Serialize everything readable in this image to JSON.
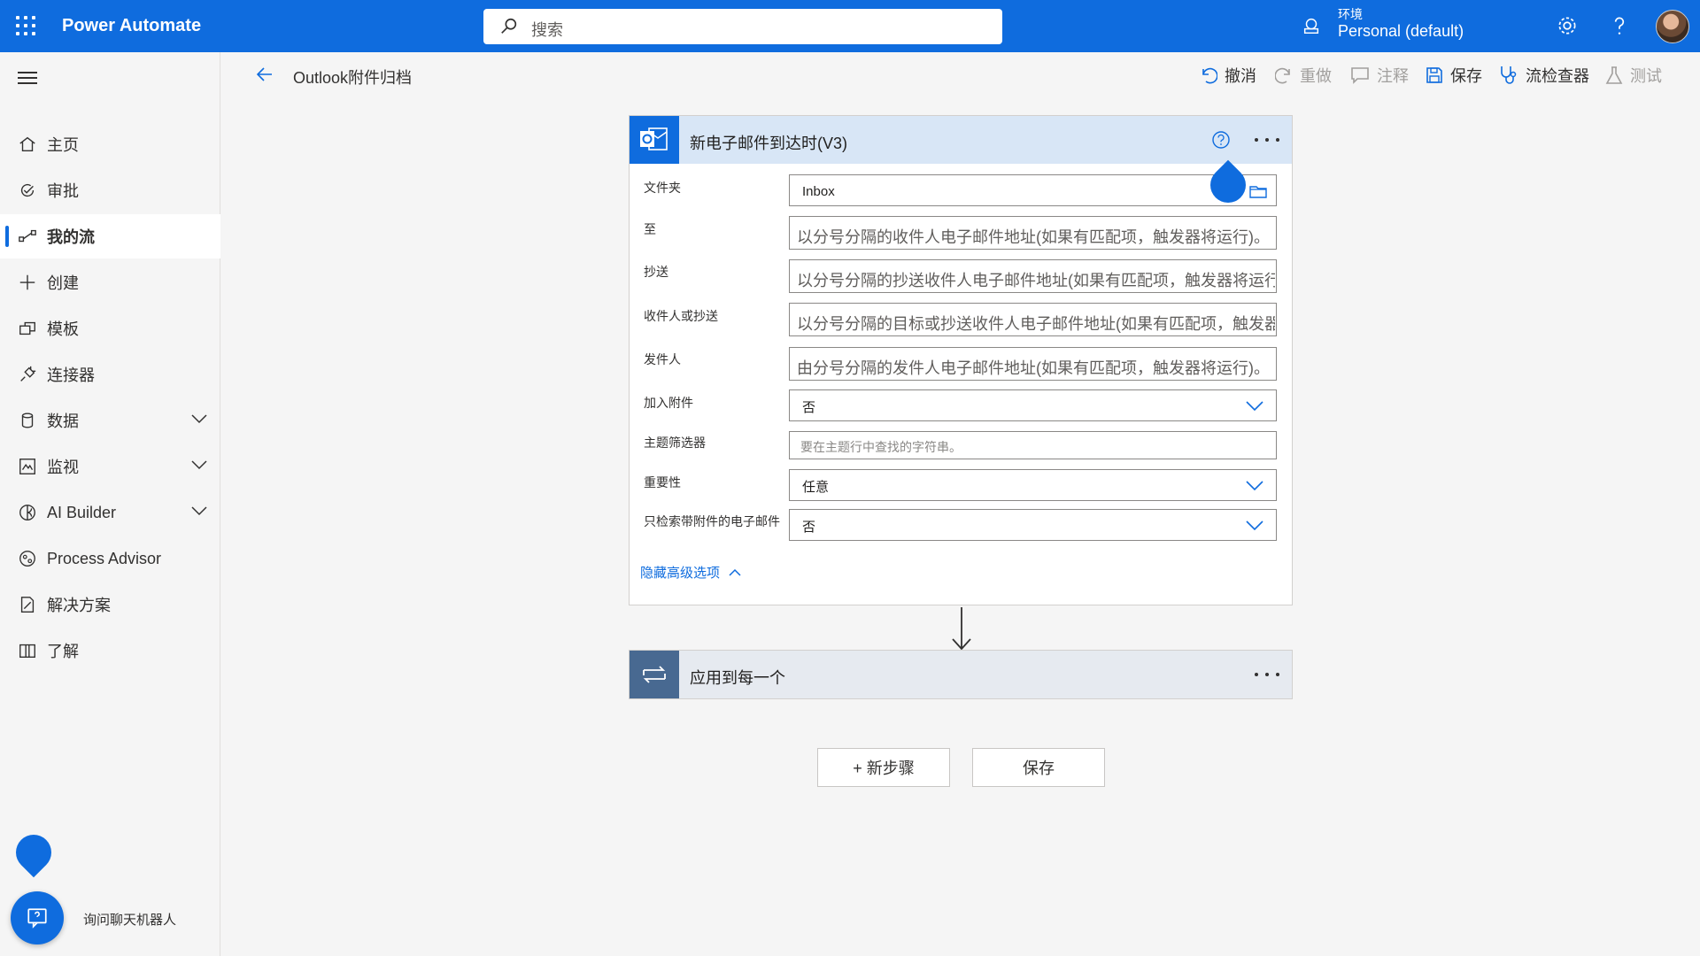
{
  "app": {
    "title": "Power Automate"
  },
  "search": {
    "placeholder": "搜索"
  },
  "environment": {
    "label": "环境",
    "value": "Personal (default)"
  },
  "sidebar": {
    "items": [
      {
        "label": "主页",
        "icon": "home-icon"
      },
      {
        "label": "审批",
        "icon": "approvals-icon"
      },
      {
        "label": "我的流",
        "icon": "flow-icon",
        "active": true
      },
      {
        "label": "创建",
        "icon": "plus-icon"
      },
      {
        "label": "模板",
        "icon": "template-icon"
      },
      {
        "label": "连接器",
        "icon": "connector-icon"
      },
      {
        "label": "数据",
        "icon": "database-icon",
        "expandable": true
      },
      {
        "label": "监视",
        "icon": "monitor-icon",
        "expandable": true
      },
      {
        "label": "AI Builder",
        "icon": "ai-builder-icon",
        "expandable": true
      },
      {
        "label": "Process Advisor",
        "icon": "process-advisor-icon"
      },
      {
        "label": "解决方案",
        "icon": "solutions-icon"
      },
      {
        "label": "了解",
        "icon": "book-icon"
      }
    ],
    "chatbot_label": "询问聊天机器人"
  },
  "commandbar": {
    "flow_title": "Outlook附件归档",
    "undo": "撤消",
    "redo": "重做",
    "comment": "注释",
    "save": "保存",
    "checker": "流检查器",
    "test": "测试"
  },
  "trigger": {
    "title": "新电子邮件到达时(V3)",
    "fields": {
      "folder": {
        "label": "文件夹",
        "value": "Inbox"
      },
      "to": {
        "label": "至",
        "placeholder": "以分号分隔的收件人电子邮件地址(如果有匹配项，触发器将运行)。"
      },
      "cc": {
        "label": "抄送",
        "placeholder": "以分号分隔的抄送收件人电子邮件地址(如果有匹配项，触发器将运行)。"
      },
      "to_or_cc": {
        "label": "收件人或抄送",
        "placeholder": "以分号分隔的目标或抄送收件人电子邮件地址(如果有匹配项，触发器将运行)。"
      },
      "from": {
        "label": "发件人",
        "placeholder": "由分号分隔的发件人电子邮件地址(如果有匹配项，触发器将运行)。"
      },
      "include_attachments": {
        "label": "加入附件",
        "value": "否"
      },
      "subject_filter": {
        "label": "主题筛选器",
        "placeholder": "要在主题行中查找的字符串。"
      },
      "importance": {
        "label": "重要性",
        "value": "任意"
      },
      "only_with_attachments": {
        "label": "只检索带附件的电子邮件",
        "value": "否"
      }
    },
    "hide_advanced": "隐藏高级选项"
  },
  "apply_each": {
    "title": "应用到每一个"
  },
  "actions": {
    "new_step": "+ 新步骤",
    "save": "保存"
  },
  "colors": {
    "brand": "#0f6cde",
    "trigger_header": "#d8e6f6",
    "loop_badge": "#486991"
  }
}
